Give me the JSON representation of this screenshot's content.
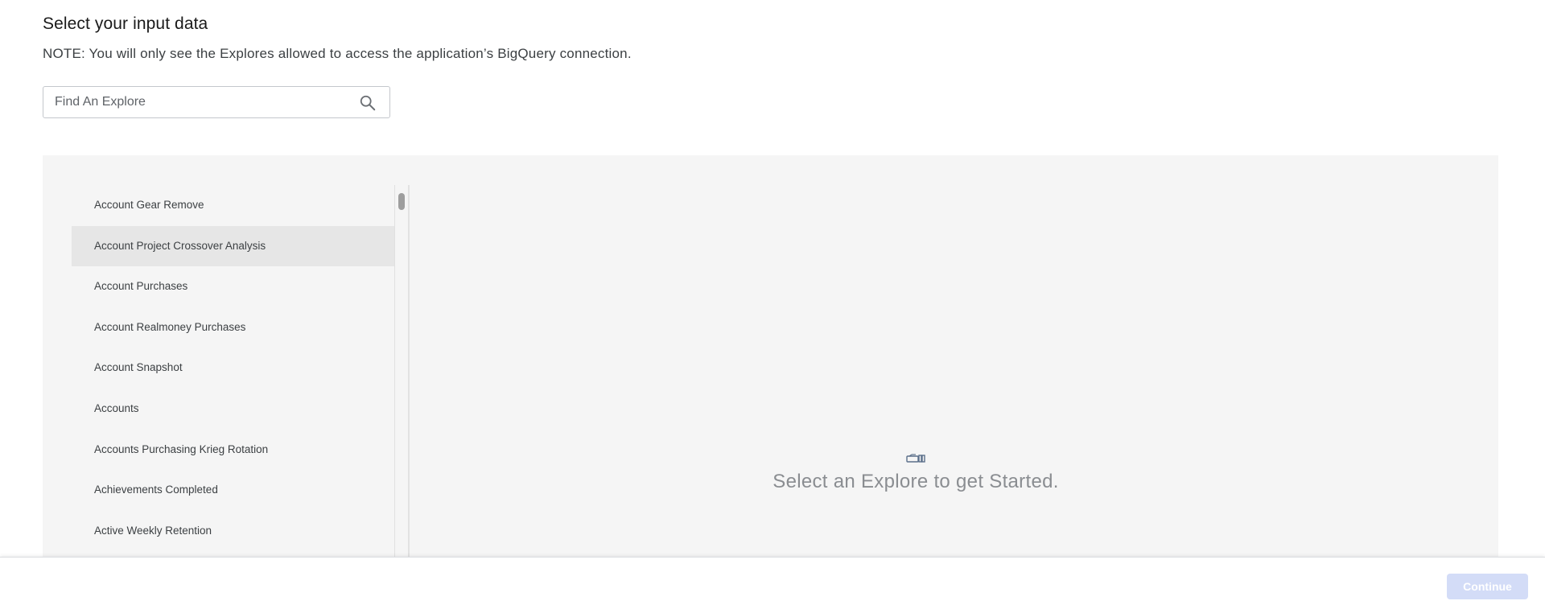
{
  "header": {
    "title": "Select your input data",
    "note": "NOTE: You will only see the Explores allowed to access the application’s BigQuery connection."
  },
  "search": {
    "placeholder": "Find An Explore",
    "value": "",
    "icon": "search-icon"
  },
  "explores": {
    "items": [
      {
        "label": "Account Gear Remove",
        "selected": false
      },
      {
        "label": "Account Project Crossover Analysis",
        "selected": true
      },
      {
        "label": "Account Purchases",
        "selected": false
      },
      {
        "label": "Account Realmoney Purchases",
        "selected": false
      },
      {
        "label": "Account Snapshot",
        "selected": false
      },
      {
        "label": "Accounts",
        "selected": false
      },
      {
        "label": "Accounts Purchasing Krieg Rotation",
        "selected": false
      },
      {
        "label": "Achievements Completed",
        "selected": false
      },
      {
        "label": "Active Weekly Retention",
        "selected": false
      }
    ]
  },
  "empty_state": {
    "icon": "explore-cube-icon",
    "message": "Select an Explore to get Started."
  },
  "footer": {
    "continue_label": "Continue",
    "continue_disabled": true
  },
  "colors": {
    "panel_bg": "#f5f5f5",
    "selected_item_bg": "#e6e6e6",
    "continue_disabled_bg": "#d3dcf7"
  }
}
